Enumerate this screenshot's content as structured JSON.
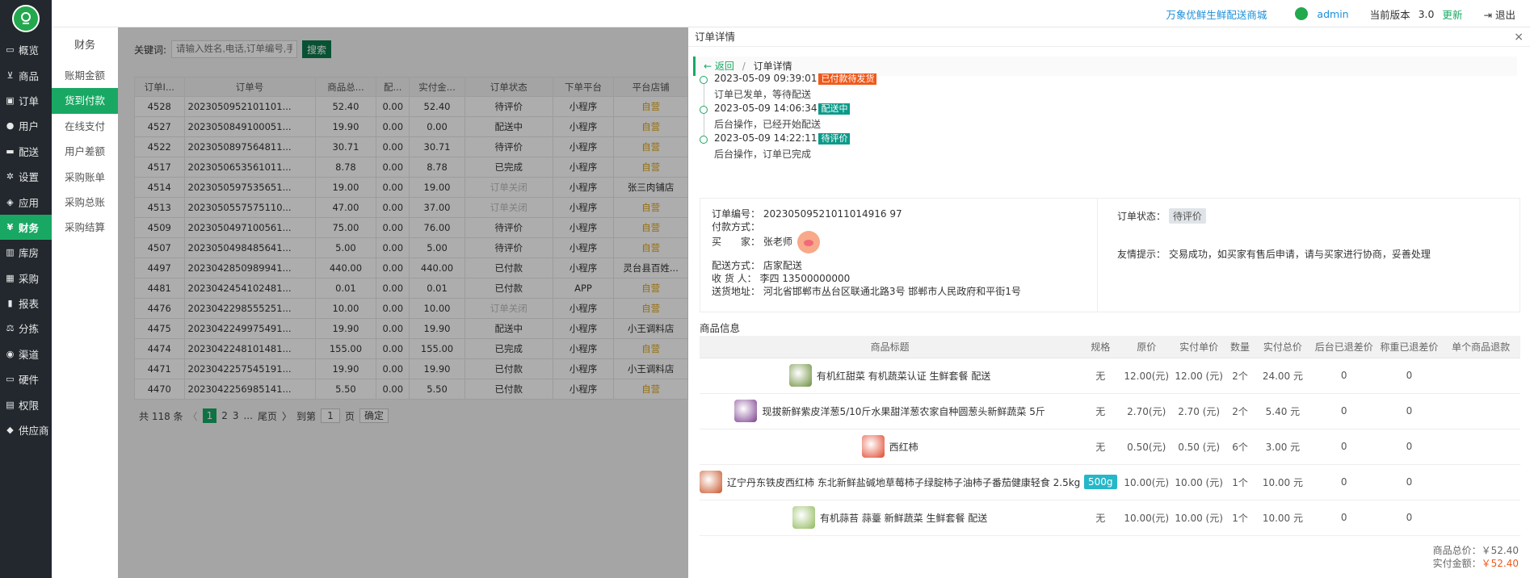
{
  "header": {
    "store_link": "万象优鲜生鲜配送商城",
    "user": "admin",
    "version_label": "当前版本",
    "version": "3.0",
    "update": "更新",
    "logout": "退出"
  },
  "logo_text": "万象优鲜",
  "nav": [
    "概览",
    "商品",
    "订单",
    "用户",
    "配送",
    "设置",
    "应用",
    "财务",
    "库房",
    "采购",
    "报表",
    "分拣",
    "渠道",
    "硬件",
    "权限",
    "供应商"
  ],
  "nav_icons": [
    "monitor-icon",
    "cart-icon",
    "order-icon",
    "user-icon",
    "truck-icon",
    "gear-icon",
    "app-icon",
    "yen-icon",
    "warehouse-icon",
    "purchase-icon",
    "chart-icon",
    "scale-icon",
    "channel-icon",
    "hardware-icon",
    "bank-icon",
    "supplier-icon"
  ],
  "subnav": {
    "title": "财务",
    "items": [
      "账期金额",
      "货到付款",
      "在线支付",
      "用户差额",
      "采购账单",
      "采购总账",
      "采购结算"
    ]
  },
  "search": {
    "label": "关键词:",
    "placeholder": "请输入姓名,电话,订单编号,手",
    "button": "搜索"
  },
  "orders": {
    "columns": [
      "订单I...",
      "订单号",
      "商品总...",
      "配...",
      "实付金...",
      "订单状态",
      "下单平台",
      "平台店铺"
    ],
    "rows": [
      [
        "4528",
        "2023050952101101...",
        "52.40",
        "0.00",
        "52.40",
        "待评价",
        "小程序",
        "自营"
      ],
      [
        "4527",
        "2023050849100051...",
        "19.90",
        "0.00",
        "0.00",
        "配送中",
        "小程序",
        "自营"
      ],
      [
        "4522",
        "2023050897564811...",
        "30.71",
        "0.00",
        "30.71",
        "待评价",
        "小程序",
        "自营"
      ],
      [
        "4517",
        "2023050653561011...",
        "8.78",
        "0.00",
        "8.78",
        "已完成",
        "小程序",
        "自营"
      ],
      [
        "4514",
        "2023050597535651...",
        "19.00",
        "0.00",
        "19.00",
        "订单关闭",
        "小程序",
        "张三肉铺店"
      ],
      [
        "4513",
        "2023050557575110...",
        "47.00",
        "0.00",
        "37.00",
        "订单关闭",
        "小程序",
        "自营"
      ],
      [
        "4509",
        "2023050497100561...",
        "75.00",
        "0.00",
        "76.00",
        "待评价",
        "小程序",
        "自营"
      ],
      [
        "4507",
        "2023050498485641...",
        "5.00",
        "0.00",
        "5.00",
        "待评价",
        "小程序",
        "自营"
      ],
      [
        "4497",
        "2023042850989941...",
        "440.00",
        "0.00",
        "440.00",
        "已付款",
        "小程序",
        "灵台县百姓..."
      ],
      [
        "4481",
        "2023042454102481...",
        "0.01",
        "0.00",
        "0.01",
        "已付款",
        "APP",
        "自营"
      ],
      [
        "4476",
        "2023042298555251...",
        "10.00",
        "0.00",
        "10.00",
        "订单关闭",
        "小程序",
        "自营"
      ],
      [
        "4475",
        "2023042249975491...",
        "19.90",
        "0.00",
        "19.90",
        "配送中",
        "小程序",
        "小王调料店"
      ],
      [
        "4474",
        "2023042248101481...",
        "155.00",
        "0.00",
        "155.00",
        "已完成",
        "小程序",
        "自营"
      ],
      [
        "4471",
        "2023042257545191...",
        "19.90",
        "0.00",
        "19.90",
        "已付款",
        "小程序",
        "小王调料店"
      ],
      [
        "4470",
        "2023042256985141...",
        "5.50",
        "0.00",
        "5.50",
        "已付款",
        "小程序",
        "自营"
      ]
    ]
  },
  "pager": {
    "total": "共 118 条",
    "prev": "〈",
    "pages": [
      "1",
      "2",
      "3",
      "...",
      "尾页"
    ],
    "next": "〉",
    "goto": "到第",
    "page_value": "1",
    "page_unit": "页",
    "confirm": "确定"
  },
  "panel": {
    "title": "订单详情",
    "close": "×",
    "back": "← 返回",
    "sep": "/",
    "crumb": "订单详情",
    "timeline": [
      {
        "time": "2023-05-09 09:39:01",
        "tag": "已付款待发货",
        "tag_color": "#ef5a1c",
        "desc": "订单已发单，等待配送"
      },
      {
        "time": "2023-05-09 14:06:34",
        "tag": "配送中",
        "tag_color": "#0c9a8a",
        "desc": "后台操作，已经开始配送"
      },
      {
        "time": "2023-05-09 14:22:11",
        "tag": "待评价",
        "tag_color": "#0c9a8a",
        "desc": "后台操作，订单已完成"
      }
    ],
    "info": {
      "order_no_label": "订单编号：",
      "order_no": "20230509521011014916 97",
      "pay_label": "付款方式：",
      "buyer_label": "买　　家：",
      "buyer": "张老师",
      "delivery_label": "配送方式：",
      "delivery": "店家配送",
      "receiver_label": "收 货 人：",
      "receiver": "李四 13500000000",
      "address_label": "送货地址：",
      "address": "河北省邯郸市丛台区联通北路3号 邯郸市人民政府和平街1号",
      "status_label": "订单状态：",
      "status": "待评价",
      "tip_label": "友情提示：",
      "tip": "交易成功，如买家有售后申请，请与买家进行协商，妥善处理"
    },
    "goods_title": "商品信息",
    "goods_columns": [
      "商品标题",
      "规格",
      "原价",
      "实付单价",
      "数量",
      "实付总价",
      "后台已退差价",
      "称重已退差价",
      "单个商品退款"
    ],
    "goods": [
      {
        "name": "有机红甜菜 有机蔬菜认证 生鲜套餐 配送",
        "spec": "无",
        "price": "12.00(元)",
        "unit": "12.00 (元)",
        "qty": "2个",
        "total": "24.00 元",
        "r1": "0",
        "r2": "0",
        "thumb": "#6b8e3a"
      },
      {
        "name": "现拔新鲜紫皮洋葱5/10斤水果甜洋葱农家自种圆葱头新鲜蔬菜 5斤",
        "spec": "无",
        "price": "2.70(元)",
        "unit": "2.70 (元)",
        "qty": "2个",
        "total": "5.40 元",
        "r1": "0",
        "r2": "0",
        "thumb": "#7b3f8e"
      },
      {
        "name": "西红柿",
        "spec": "无",
        "price": "0.50(元)",
        "unit": "0.50 (元)",
        "qty": "6个",
        "total": "3.00 元",
        "r1": "0",
        "r2": "0",
        "thumb": "#e0452b"
      },
      {
        "name": "辽宁丹东铁皮西红柿 东北新鲜盐碱地草莓柿子绿腚柿子油柿子番茄健康轻食 2.5kg",
        "spec": "500g",
        "price": "10.00(元)",
        "unit": "10.00 (元)",
        "qty": "1个",
        "total": "10.00 元",
        "r1": "0",
        "r2": "0",
        "thumb": "#c8552a"
      },
      {
        "name": "有机蒜苔 蒜薹 新鲜蔬菜 生鲜套餐 配送",
        "spec": "无",
        "price": "10.00(元)",
        "unit": "10.00 (元)",
        "qty": "1个",
        "total": "10.00 元",
        "r1": "0",
        "r2": "0",
        "thumb": "#8fb85a"
      }
    ],
    "totals": {
      "goods_total_label": "商品总价：",
      "goods_total": "￥52.40",
      "paid_label": "实付金额：",
      "paid": "￥52.40"
    }
  },
  "colors": {
    "accent": "#19a863",
    "nav_bg": "#22282e",
    "red": "#ef5a1c"
  }
}
